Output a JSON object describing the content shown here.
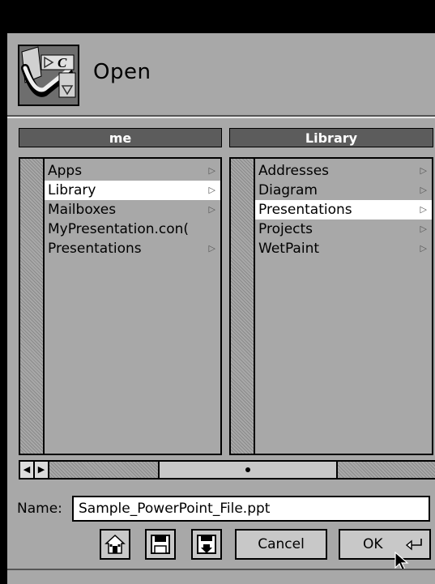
{
  "window": {
    "title": "Open"
  },
  "browser": {
    "left_column": {
      "header": "me",
      "items": [
        {
          "label": "Apps",
          "has_children": true,
          "selected": false
        },
        {
          "label": "Library",
          "has_children": true,
          "selected": true
        },
        {
          "label": "Mailboxes",
          "has_children": true,
          "selected": false
        },
        {
          "label": "MyPresentation.con(",
          "has_children": false,
          "selected": false
        },
        {
          "label": "Presentations",
          "has_children": true,
          "selected": false
        }
      ]
    },
    "right_column": {
      "header": "Library",
      "items": [
        {
          "label": "Addresses",
          "has_children": true,
          "selected": false
        },
        {
          "label": "Diagram",
          "has_children": true,
          "selected": false
        },
        {
          "label": "Presentations",
          "has_children": true,
          "selected": true
        },
        {
          "label": "Projects",
          "has_children": true,
          "selected": false
        },
        {
          "label": "WetPaint",
          "has_children": true,
          "selected": false
        }
      ]
    }
  },
  "name_field": {
    "label": "Name:",
    "value": "Sample_PowerPoint_File.ppt"
  },
  "buttons": {
    "cancel": "Cancel",
    "ok": "OK"
  },
  "icons": {
    "home": "home-icon",
    "disk": "floppy-disk-icon",
    "disk_down": "floppy-disk-down-icon",
    "return": "return-key-icon"
  },
  "colors": {
    "window_bg": "#a8a8a8",
    "header_bg": "#5c5c5c",
    "selection": "#ffffff"
  }
}
